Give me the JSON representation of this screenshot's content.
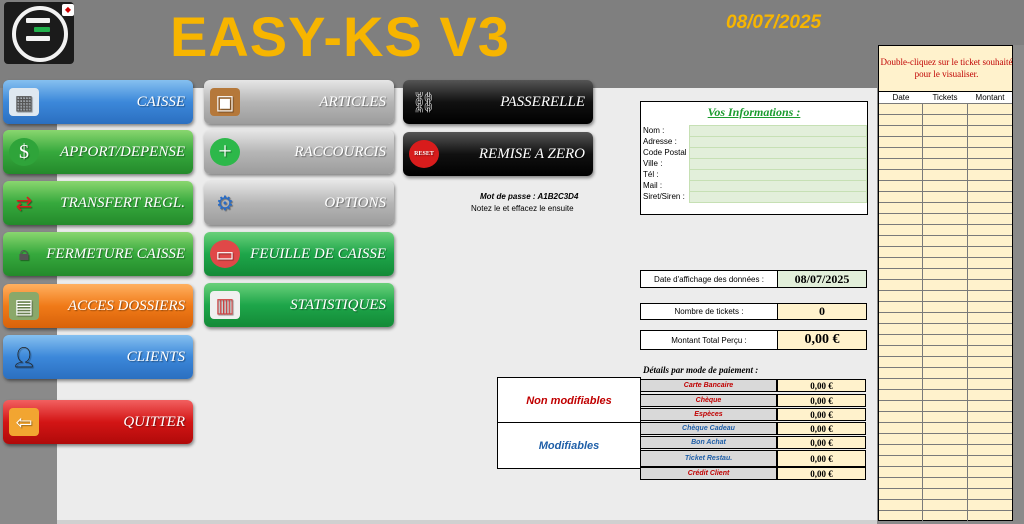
{
  "header": {
    "title": "EASY-KS V3",
    "date": "08/07/2025"
  },
  "buttons": {
    "caisse": "CAISSE",
    "apport": "APPORT/DEPENSE",
    "transfert": "TRANSFERT REGL.",
    "fermeture": "FERMETURE CAISSE",
    "acces": "ACCES DOSSIERS",
    "clients": "CLIENTS",
    "quitter": "QUITTER",
    "articles": "ARTICLES",
    "raccourcis": "RACCOURCIS",
    "options": "OPTIONS",
    "feuille": "FEUILLE DE CAISSE",
    "statistiques": "STATISTIQUES",
    "passerelle": "PASSERELLE",
    "remise": "REMISE A ZERO",
    "reset_label": "RESET"
  },
  "password": {
    "line1": "Mot de passe : A1B2C3D4",
    "line2": "Notez le et effacez le ensuite"
  },
  "info": {
    "title": "Vos Informations :",
    "fields": [
      "Nom :",
      "Adresse :",
      "Code Postal",
      "Ville :",
      "Tél :",
      "Mail :",
      "Siret/Siren :"
    ]
  },
  "stats": {
    "date_label": "Date d'affichage des données :",
    "date_value": "08/07/2025",
    "tickets_label": "Nombre de tickets :",
    "tickets_value": "0",
    "total_label": "Montant Total Perçu :",
    "total_value": "0,00 €"
  },
  "payments": {
    "title": "Détails par mode de paiement :",
    "group_fixed": "Non modifiables",
    "group_edit": "Modifiables",
    "rows": [
      {
        "name": "Carte Bancaire",
        "amount": "0,00 €",
        "color": "#c00000"
      },
      {
        "name": "Chèque",
        "amount": "0,00 €",
        "color": "#c00000"
      },
      {
        "name": "Espèces",
        "amount": "0,00 €",
        "color": "#c00000"
      },
      {
        "name": "Chèque Cadeau",
        "amount": "0,00 €",
        "color": "#1f5fa8"
      },
      {
        "name": "Bon Achat",
        "amount": "0,00 €",
        "color": "#1f5fa8"
      },
      {
        "name": "Ticket Restau.",
        "amount": "0,00 €",
        "color": "#1f5fa8"
      },
      {
        "name": "Crédit Client",
        "amount": "0,00 €",
        "color": "#c00000"
      }
    ]
  },
  "tickets_panel": {
    "message": "Double-cliquez sur le ticket souhaité pour le visualiser.",
    "col_date": "Date",
    "col_tickets": "Tickets",
    "col_montant": "Montant"
  }
}
